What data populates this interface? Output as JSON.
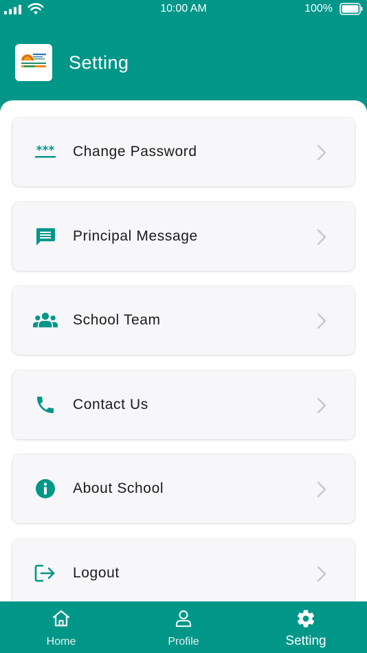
{
  "status_bar": {
    "time": "10:00 AM",
    "battery": "100%"
  },
  "header": {
    "title": "Setting"
  },
  "menu": [
    {
      "label": "Change Password",
      "icon": "password-icon"
    },
    {
      "label": "Principal Message",
      "icon": "message-icon"
    },
    {
      "label": "School Team",
      "icon": "group-icon"
    },
    {
      "label": "Contact Us",
      "icon": "phone-icon"
    },
    {
      "label": "About School",
      "icon": "info-icon"
    },
    {
      "label": "Logout",
      "icon": "logout-icon"
    }
  ],
  "nav": [
    {
      "label": "Home",
      "icon": "home-icon"
    },
    {
      "label": "Profile",
      "icon": "profile-icon"
    },
    {
      "label": "Setting",
      "icon": "gear-icon",
      "active": true
    }
  ],
  "colors": {
    "primary": "#009688",
    "card": "#f7f6f8",
    "chevron": "#c7c7cc"
  }
}
